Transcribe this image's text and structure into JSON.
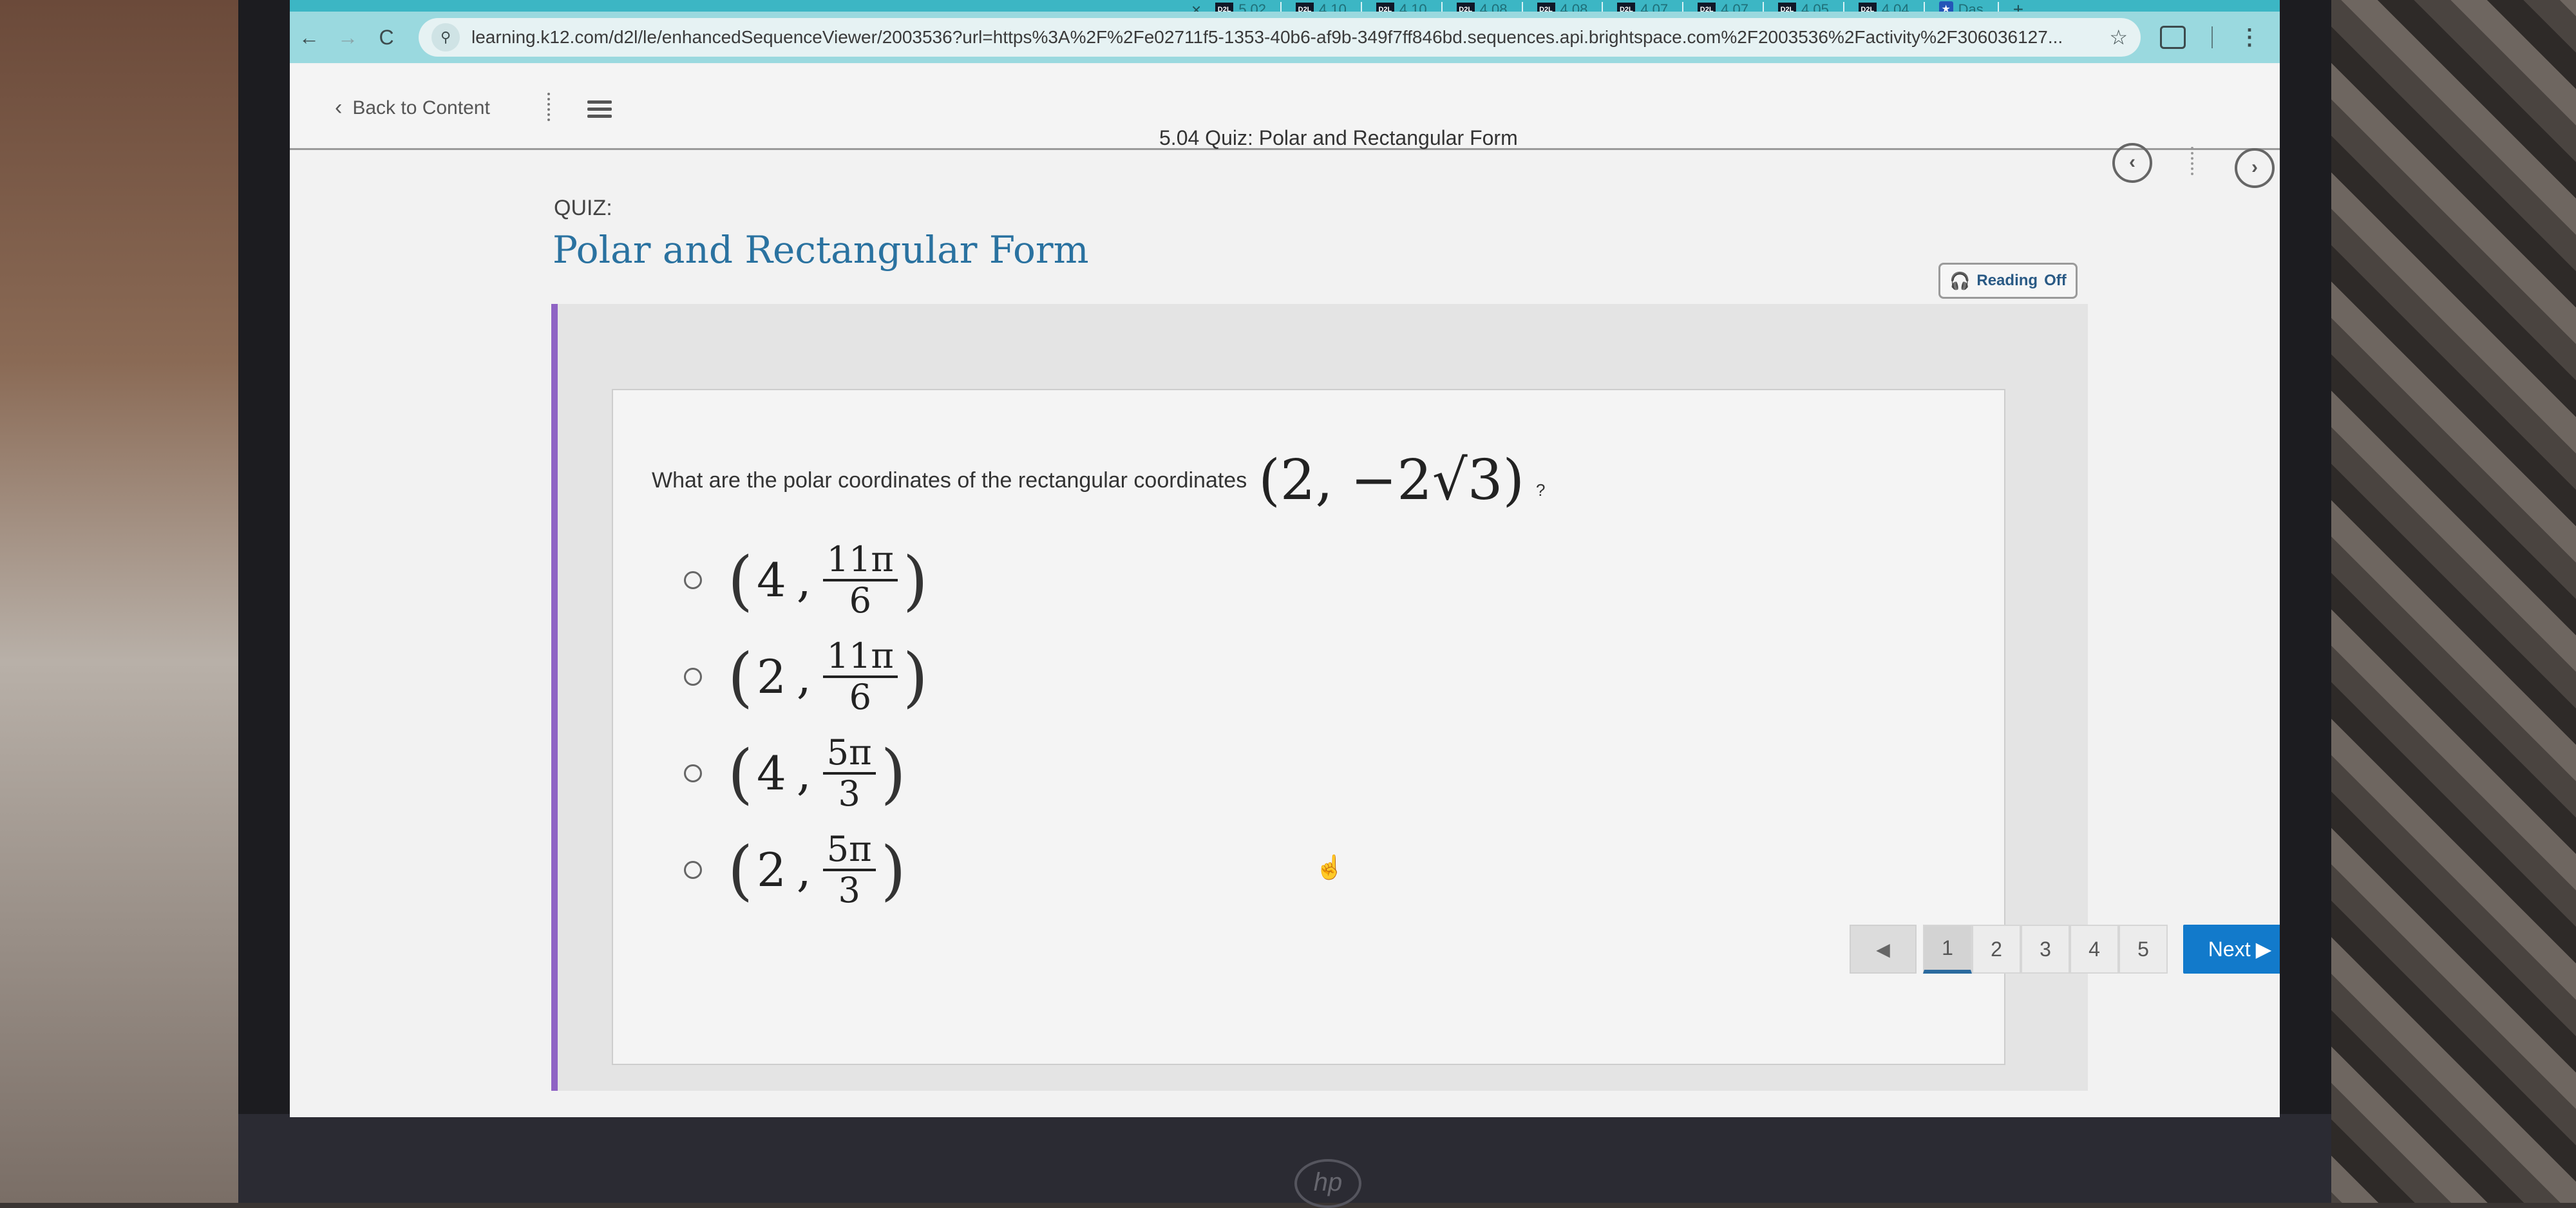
{
  "browser": {
    "tabs": [
      {
        "icon": "d2l-icon",
        "label": "5.02"
      },
      {
        "icon": "d2l-icon",
        "label": "4.10"
      },
      {
        "icon": "d2l-icon",
        "label": "4.10"
      },
      {
        "icon": "d2l-icon",
        "label": "4.08"
      },
      {
        "icon": "d2l-icon",
        "label": "4.08"
      },
      {
        "icon": "d2l-icon",
        "label": "4.07"
      },
      {
        "icon": "d2l-icon",
        "label": "4.07"
      },
      {
        "icon": "d2l-icon",
        "label": "4.05"
      },
      {
        "icon": "d2l-icon",
        "label": "4.04"
      },
      {
        "icon": "shield-star-icon",
        "label": "Das"
      }
    ],
    "tab_icon_text": "D2L",
    "tab_close": "×",
    "new_tab": "+",
    "back": "←",
    "forward": "→",
    "reload": "C",
    "url": "learning.k12.com/d2l/le/enhancedSequenceViewer/2003536?url=https%3A%2F%2Fe02711f5-1353-40b6-af9b-349f7ff846bd.sequences.api.brightspace.com%2F2003536%2Factivity%2F306036127...",
    "star": "☆",
    "menu": "⋮",
    "site_info": "⚲"
  },
  "header": {
    "back_label": "Back to Content",
    "back_chevron": "‹",
    "activity_title": "5.04 Quiz: Polar and Rectangular Form",
    "prev_activity": "‹",
    "next_activity": "›"
  },
  "quiz": {
    "label": "QUIZ:",
    "title": "Polar and Rectangular Form",
    "reading": {
      "label": "Reading",
      "state": "Off",
      "icon": "🎧"
    }
  },
  "question": {
    "text": "What are the polar coordinates of the rectangular coordinates",
    "math": "(2, −2√3)",
    "suffix": "?"
  },
  "options": [
    {
      "r": "4",
      "num": "11π",
      "den": "6"
    },
    {
      "r": "2",
      "num": "11π",
      "den": "6"
    },
    {
      "r": "4",
      "num": "5π",
      "den": "3"
    },
    {
      "r": "2",
      "num": "5π",
      "den": "3"
    }
  ],
  "math_symbols": {
    "open": "(",
    "close": ")",
    "comma": ","
  },
  "pager": {
    "prev": "◀",
    "pages": [
      "1",
      "2",
      "3",
      "4",
      "5"
    ],
    "current_page": "1",
    "next_label": "Next",
    "next_arrow": "▶"
  },
  "cursor": "☝",
  "brand": {
    "hp": "hp"
  },
  "colors": {
    "accent": "#127acb",
    "title": "#2a72a0",
    "frame_border": "#8f63c4",
    "tabstrip": "#3cb6c4"
  }
}
